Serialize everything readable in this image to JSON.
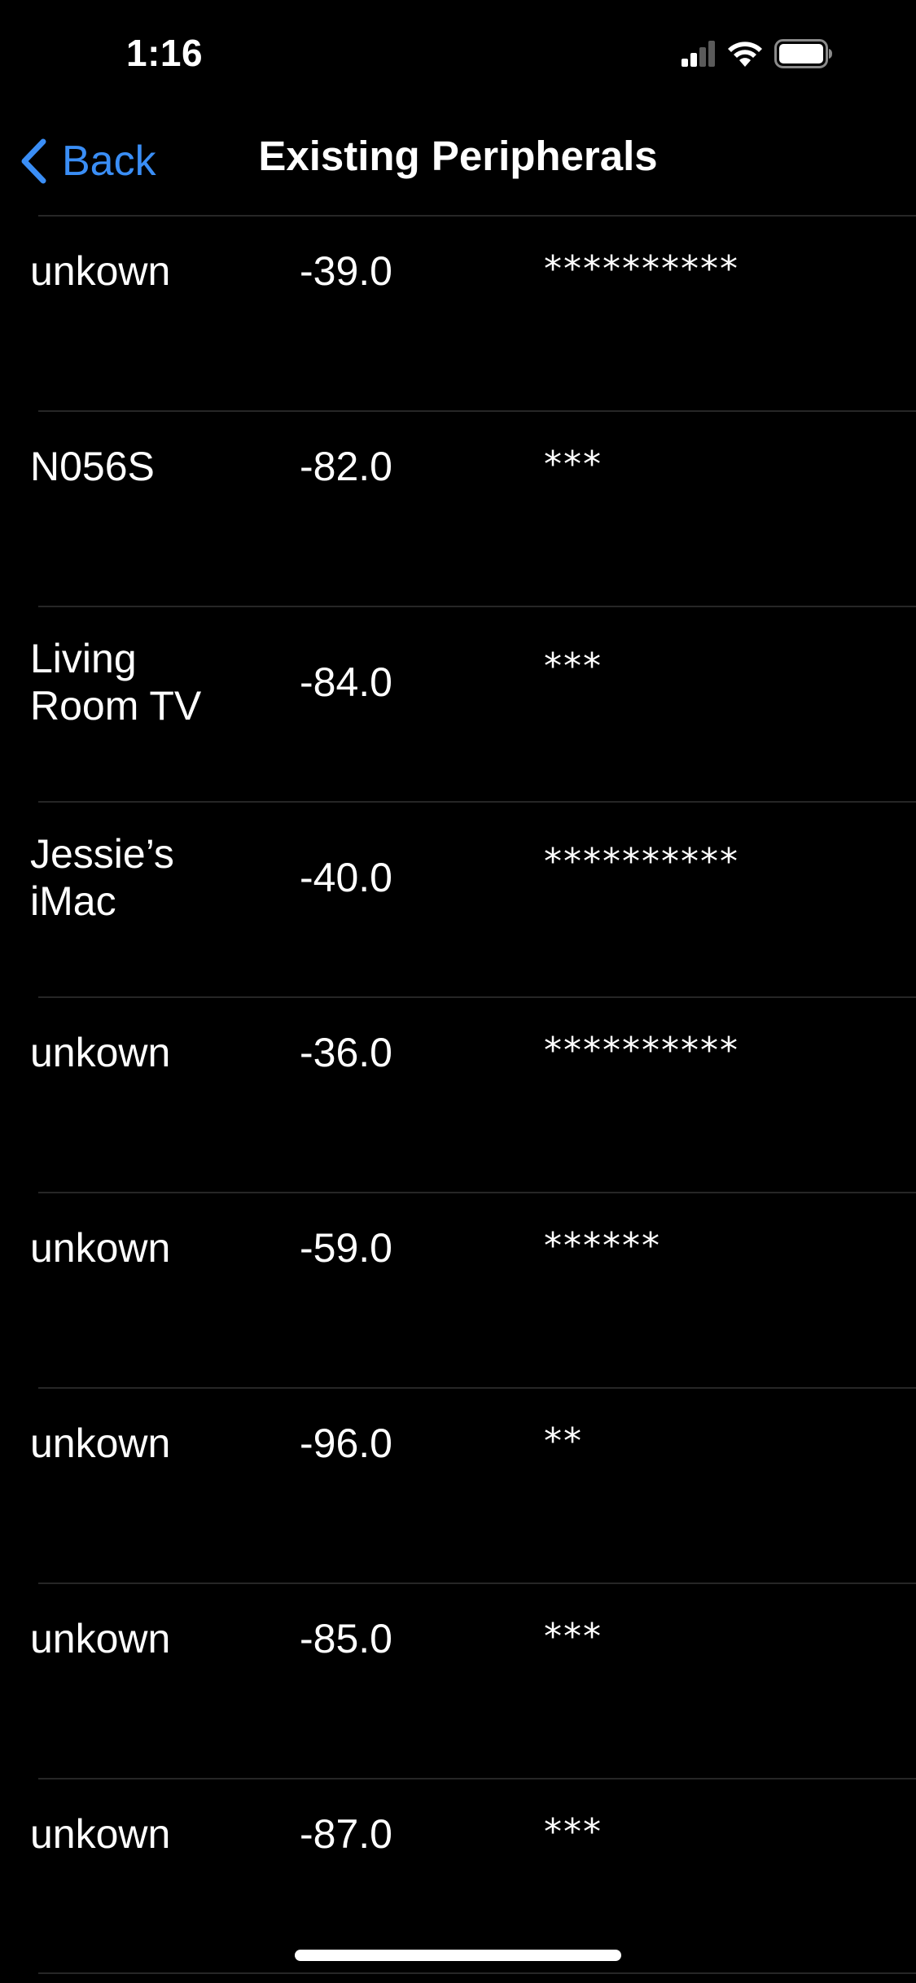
{
  "status_bar": {
    "time": "1:16",
    "icons": [
      "cellular-signal-icon",
      "wifi-icon",
      "battery-icon"
    ]
  },
  "nav": {
    "back_label": "Back",
    "title": "Existing Peripherals",
    "accent_color": "#3a8ef6"
  },
  "peripherals": [
    {
      "name": "unkown",
      "rssi": "-39.0",
      "stars": "**********"
    },
    {
      "name": "N056S",
      "rssi": "-82.0",
      "stars": "***"
    },
    {
      "name": "Living Room TV",
      "rssi": "-84.0",
      "stars": "***"
    },
    {
      "name": "Jessie’s iMac",
      "rssi": "-40.0",
      "stars": "**********"
    },
    {
      "name": "unkown",
      "rssi": "-36.0",
      "stars": "**********"
    },
    {
      "name": "unkown",
      "rssi": "-59.0",
      "stars": "******"
    },
    {
      "name": "unkown",
      "rssi": "-96.0",
      "stars": "**"
    },
    {
      "name": "unkown",
      "rssi": "-85.0",
      "stars": "***"
    },
    {
      "name": "unkown",
      "rssi": "-87.0",
      "stars": "***"
    }
  ]
}
